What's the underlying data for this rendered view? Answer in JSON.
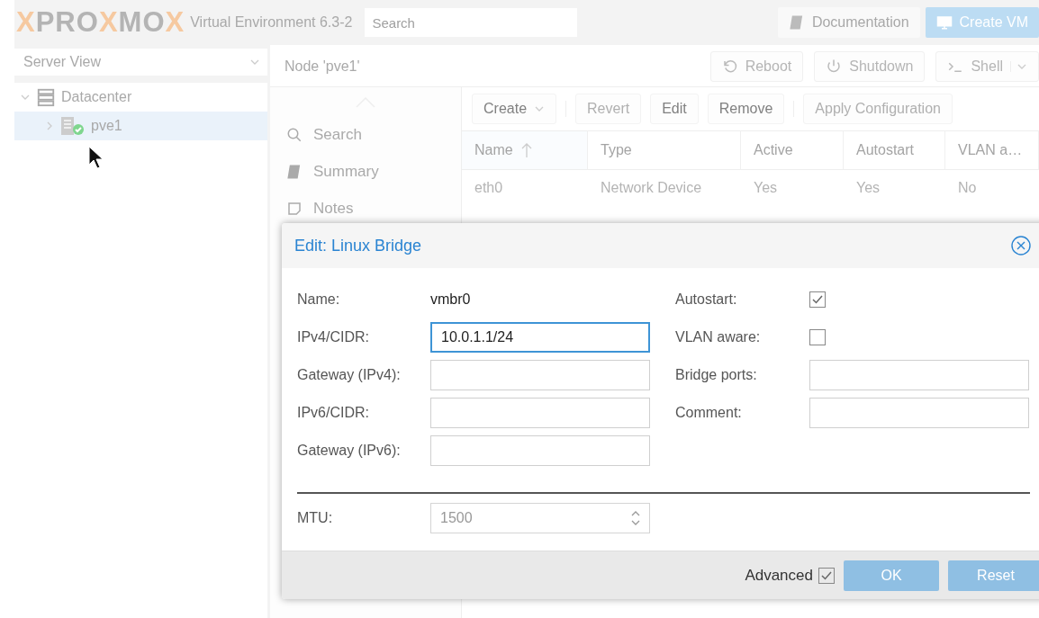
{
  "header": {
    "logo": [
      {
        "text": "X",
        "accent": true
      },
      {
        "text": "PRO",
        "accent": false
      },
      {
        "text": "X",
        "accent": true
      },
      {
        "text": "MO",
        "accent": false
      },
      {
        "text": "X",
        "accent": true
      }
    ],
    "version": "Virtual Environment 6.3-2",
    "search": {
      "placeholder": "Search"
    },
    "buttons": [
      {
        "label": "Documentation",
        "kind": "plain"
      },
      {
        "label": "Create VM",
        "kind": "primary"
      }
    ]
  },
  "sidebar": {
    "view_select": "Server View",
    "tree": [
      {
        "label": "Datacenter",
        "expanded": true,
        "selected": false,
        "children": [
          {
            "label": "pve1",
            "expanded": false,
            "selected": true
          }
        ]
      }
    ]
  },
  "node": {
    "title": "Node 'pve1'",
    "buttons": [
      {
        "label": "Reboot",
        "menu": false
      },
      {
        "label": "Shutdown",
        "menu": false
      },
      {
        "label": "Shell",
        "menu": true
      }
    ],
    "nav": [
      {
        "label": "Search"
      },
      {
        "label": "Summary"
      },
      {
        "label": "Notes"
      }
    ],
    "toolbar": [
      {
        "kind": "menu",
        "label": "Create",
        "disabled": false
      },
      {
        "kind": "separator"
      },
      {
        "kind": "button",
        "label": "Revert",
        "disabled": true
      },
      {
        "kind": "button",
        "label": "Edit",
        "disabled": false
      },
      {
        "kind": "button",
        "label": "Remove",
        "disabled": false
      },
      {
        "kind": "separator"
      },
      {
        "kind": "button",
        "label": "Apply Configuration",
        "disabled": true
      }
    ],
    "table": {
      "columns": [
        {
          "label": "Name",
          "sorted": true
        },
        {
          "label": "Type",
          "sorted": false
        },
        {
          "label": "Active",
          "sorted": false
        },
        {
          "label": "Autostart",
          "sorted": false
        },
        {
          "label": "VLAN a…",
          "sorted": false
        }
      ],
      "rows": [
        [
          "eth0",
          "Network Device",
          "Yes",
          "Yes",
          "No"
        ]
      ]
    }
  },
  "dialog": {
    "title": "Edit: Linux Bridge",
    "left": [
      {
        "kind": "display",
        "label": "Name:",
        "value": "vmbr0"
      },
      {
        "kind": "text",
        "label": "IPv4/CIDR:",
        "value": "10.0.1.1/24",
        "focused": true
      },
      {
        "kind": "text",
        "label": "Gateway (IPv4):",
        "focused": false
      },
      {
        "kind": "text",
        "label": "IPv6/CIDR:",
        "focused": false
      },
      {
        "kind": "text",
        "label": "Gateway (IPv6):",
        "focused": false
      }
    ],
    "right": [
      {
        "kind": "checkbox",
        "label": "Autostart:",
        "checked": true
      },
      {
        "kind": "checkbox",
        "label": "VLAN aware:",
        "checked": false
      },
      {
        "kind": "text",
        "label": "Bridge ports:",
        "focused": false
      },
      {
        "kind": "text",
        "label": "Comment:",
        "focused": false
      }
    ],
    "advanced": [
      {
        "kind": "spinner",
        "label": "MTU:",
        "placeholder": "1500"
      }
    ],
    "advanced_toggle": {
      "label": "Advanced",
      "checked": true
    },
    "buttons": [
      {
        "label": "OK",
        "disabled": true
      },
      {
        "label": "Reset",
        "disabled": true
      }
    ]
  }
}
